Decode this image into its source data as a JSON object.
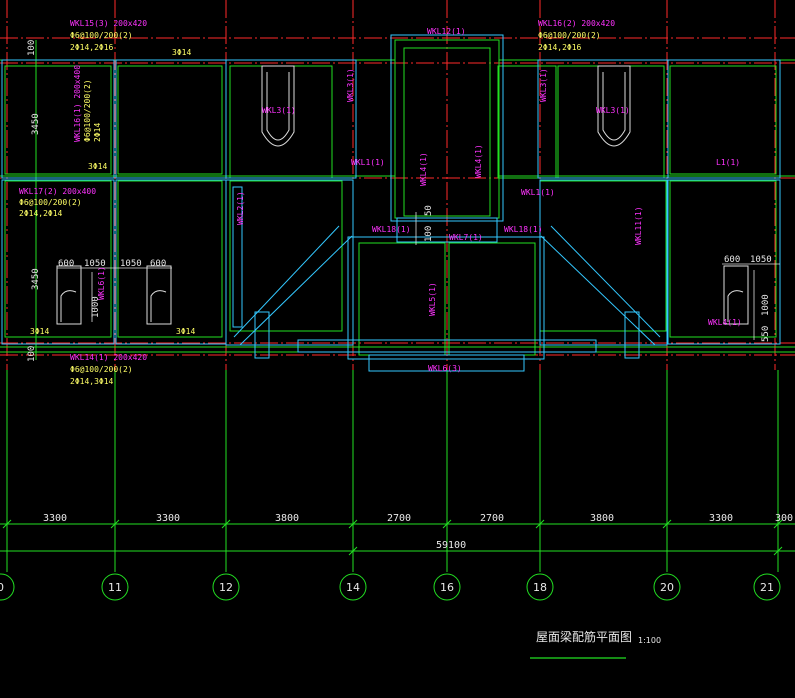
{
  "drawing": {
    "title": "屋面梁配筋平面图",
    "scale": "1:100"
  },
  "axes": {
    "labels": [
      "0",
      "11",
      "12",
      "14",
      "16",
      "18",
      "20",
      "21"
    ]
  },
  "dimensions": {
    "bays": [
      "3300",
      "3300",
      "3800",
      "2700",
      "2700",
      "3800",
      "3300",
      "300"
    ],
    "total": "59100",
    "vertical": [
      "100",
      "3450",
      "3450",
      "100"
    ],
    "small": [
      "600",
      "1050",
      "1050",
      "600",
      "600",
      "1050",
      "1000",
      "1000",
      "550",
      "100",
      "50"
    ]
  },
  "beam_labels": {
    "wkl15_name": "WKL15(3) 200x420",
    "wkl15_stir": "Φ6@100/200(2)",
    "wkl15_bars": "2Φ14,2Φ16",
    "wkl16_name": "WKL16(2) 200x420",
    "wkl16_stir": "Φ6@100/200(2)",
    "wkl16_bars": "2Φ14,2Φ16",
    "wkl16b_name": "WKL16(1) 200x400",
    "wkl16b_stir": "Φ6@100/200(2)",
    "wkl16b_bars": "2Φ14",
    "wkl17_name": "WKL17(2) 200x400",
    "wkl17_stir": "Φ6@100/200(2)",
    "wkl17_bars": "2Φ14,2Φ14",
    "wkl14_name": "WKL14(1) 200x420",
    "wkl14_stir": "Φ6@100/200(2)",
    "wkl14_bars": "2Φ14,3Φ14",
    "wkl12": "WKL12(1)",
    "wkl3_a": "WKL3(1)",
    "wkl3_b": "WKL3(1)",
    "wkl3_c": "WKL3(1)",
    "wkl3_d": "WKL3(1)",
    "wkl1_a": "WKL1(1)",
    "wkl1_b": "WKL1(1)",
    "wkl4_a": "WKL4(1)",
    "wkl4_b": "WKL4(1)",
    "wkl2": "WKL2(1)",
    "wkl18_a": "WKL18(1)",
    "wkl18_b": "WKL18(1)",
    "wkl7": "WKL7(1)",
    "wkl5": "WKL5(1)",
    "wkl6": "WKL6(3)",
    "wkl11": "WKL11(1)",
    "wkl4_c": "WKL4(1)",
    "wkl6_side": "WKL6(1)",
    "l1": "L1(1)",
    "bar_3a": "3Φ14",
    "bar_3b": "3Φ14",
    "bar_3c": "3Φ14",
    "bar_3d": "3Φ14"
  }
}
